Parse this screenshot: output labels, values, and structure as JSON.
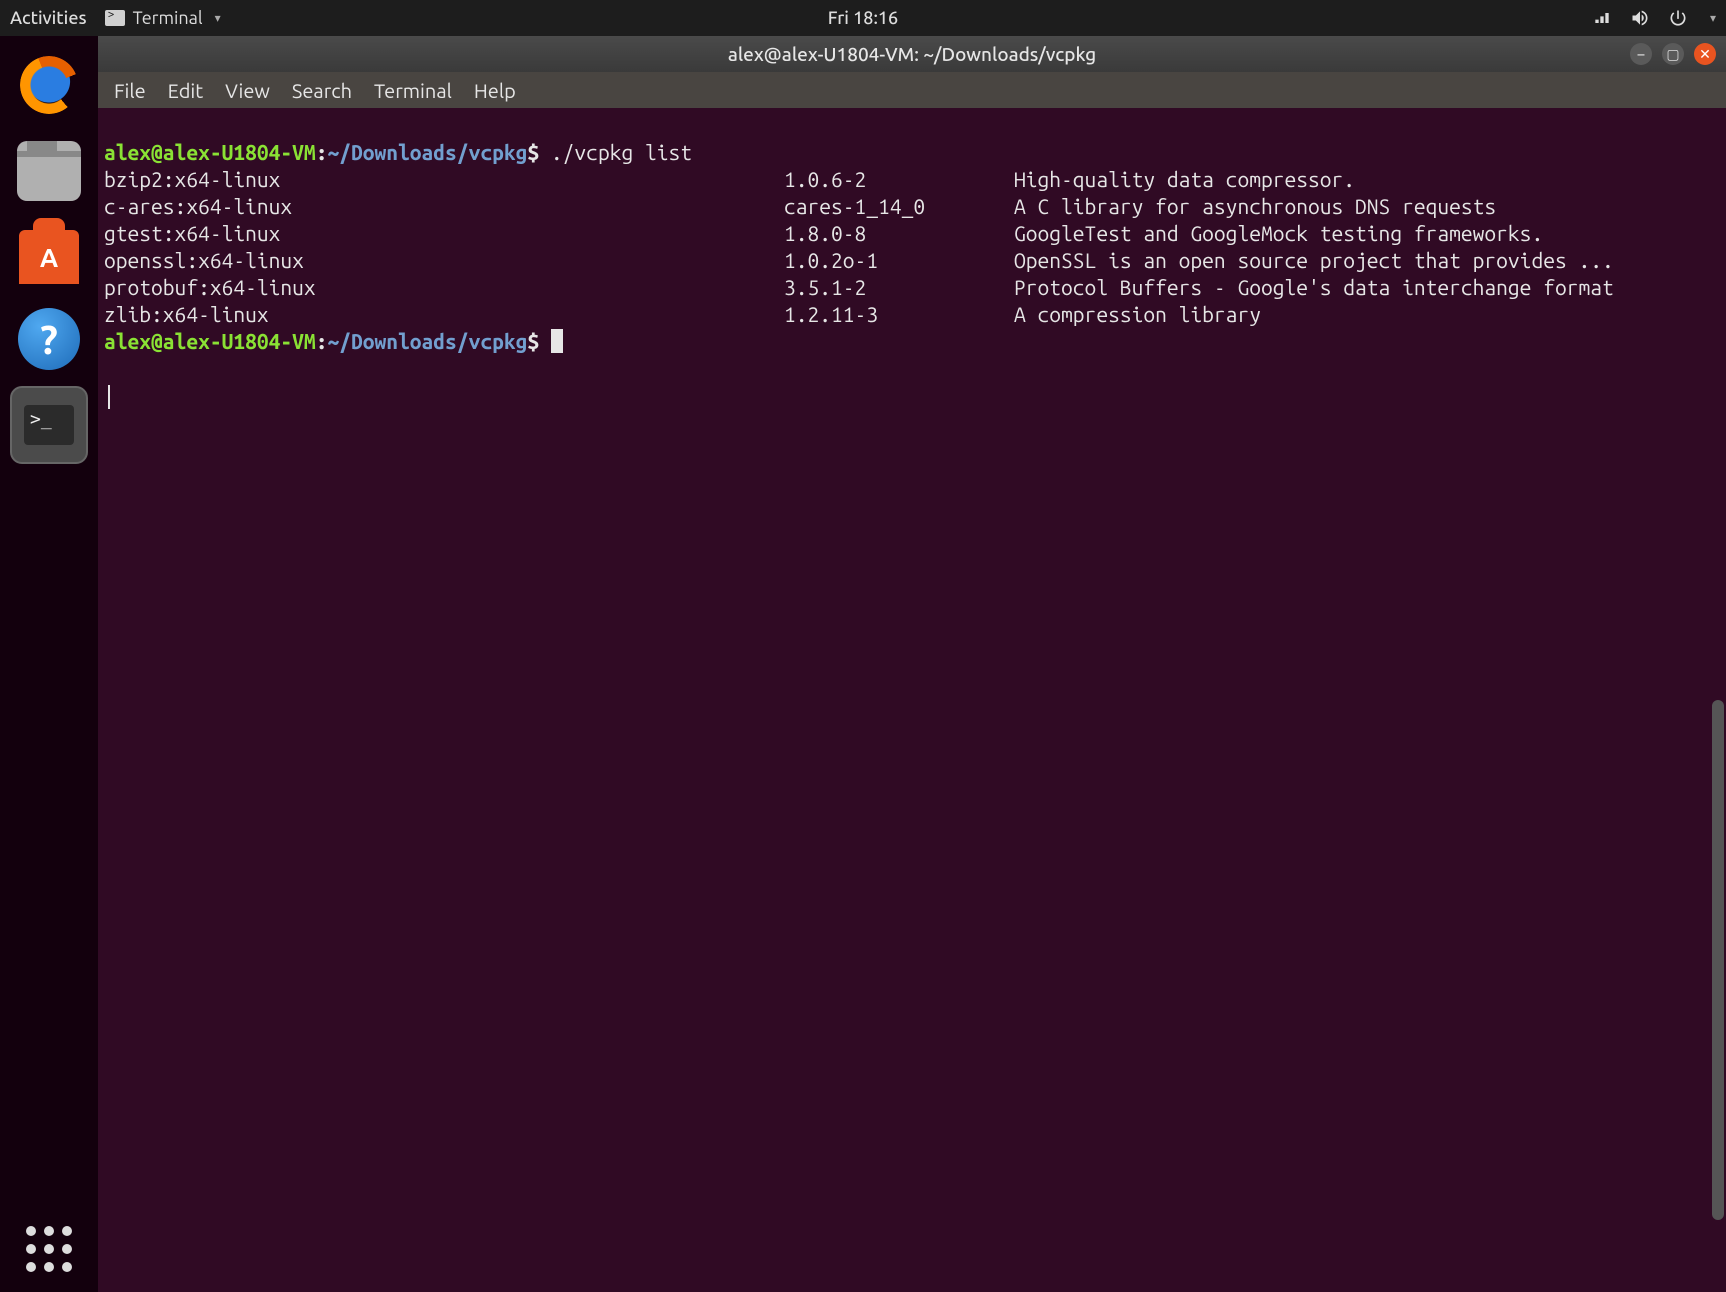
{
  "topbar": {
    "activities": "Activities",
    "app_indicator": "Terminal",
    "clock": "Fri 18:16"
  },
  "dock": {
    "items": [
      {
        "name": "firefox",
        "label": "Firefox"
      },
      {
        "name": "files",
        "label": "Files"
      },
      {
        "name": "software",
        "label": "Ubuntu Software"
      },
      {
        "name": "help",
        "label": "Help"
      },
      {
        "name": "terminal",
        "label": "Terminal"
      }
    ]
  },
  "window": {
    "title": "alex@alex-U1804-VM: ~/Downloads/vcpkg",
    "controls": {
      "minimize": "–",
      "maximize": "▢",
      "close": "✕"
    }
  },
  "menubar": {
    "file": "File",
    "edit": "Edit",
    "view": "View",
    "search": "Search",
    "terminal": "Terminal",
    "help": "Help"
  },
  "prompt": {
    "user_host": "alex@alex-U1804-VM",
    "colon": ":",
    "path": "~/Downloads/vcpkg",
    "dollar": "$",
    "command": "./vcpkg list"
  },
  "packages": [
    {
      "name": "bzip2:x64-linux",
      "version": "1.0.6-2",
      "desc": "High-quality data compressor."
    },
    {
      "name": "c-ares:x64-linux",
      "version": "cares-1_14_0",
      "desc": "A C library for asynchronous DNS requests"
    },
    {
      "name": "gtest:x64-linux",
      "version": "1.8.0-8",
      "desc": "GoogleTest and GoogleMock testing frameworks."
    },
    {
      "name": "openssl:x64-linux",
      "version": "1.0.2o-1",
      "desc": "OpenSSL is an open source project that provides ..."
    },
    {
      "name": "protobuf:x64-linux",
      "version": "3.5.1-2",
      "desc": "Protocol Buffers - Google's data interchange format"
    },
    {
      "name": "zlib:x64-linux",
      "version": "1.2.11-3",
      "desc": "A compression library"
    }
  ],
  "colors": {
    "term_bg": "#300a24",
    "prompt_user": "#8ae234",
    "prompt_path": "#729fcf",
    "ubuntu_orange": "#e95420"
  }
}
